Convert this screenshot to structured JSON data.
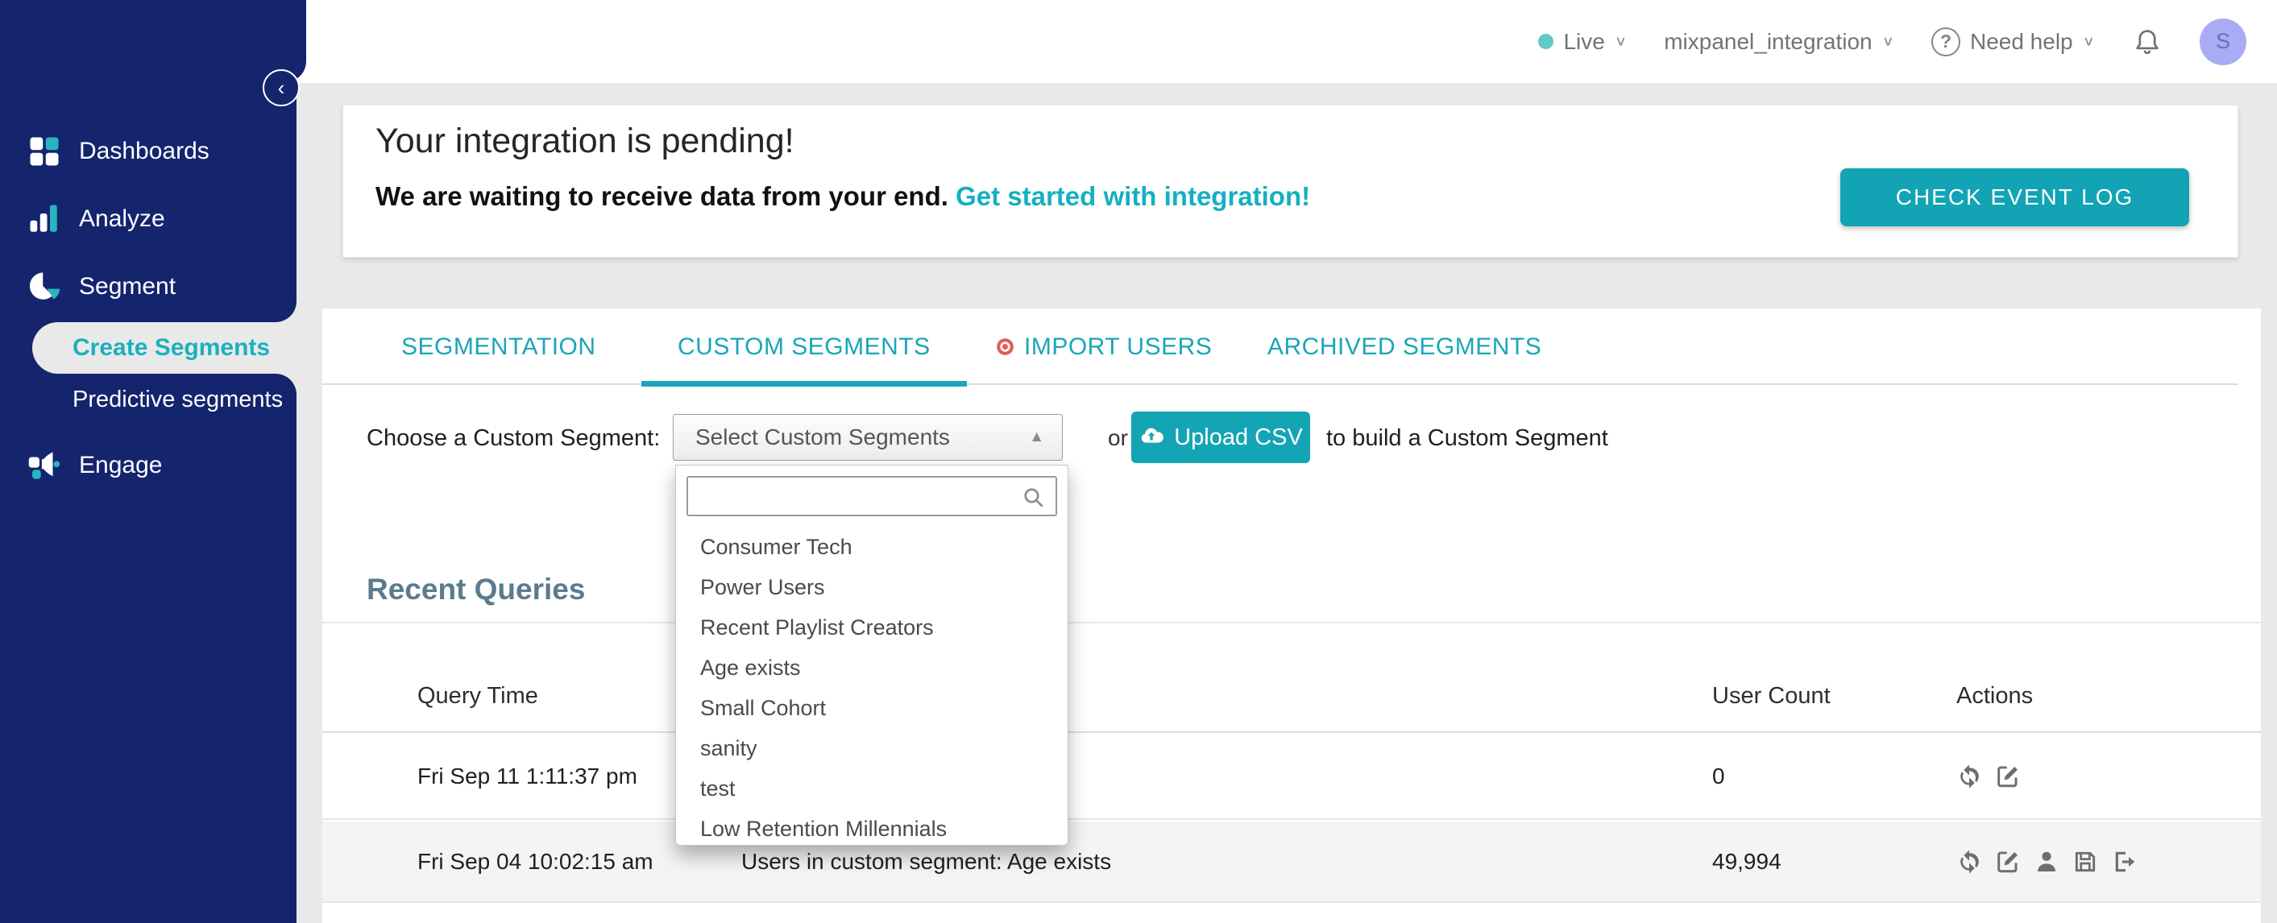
{
  "colors": {
    "navy": "#14256e",
    "accent_teal": "#14a5b5",
    "link_teal": "#14b0c0",
    "alert_red": "#e15b5b",
    "live_dot": "#62c9c3",
    "avatar_bg": "#a8acf4",
    "heading_slate": "#5b7b8e"
  },
  "sidebar": {
    "logo": "moengage",
    "items": [
      {
        "label": "Dashboards"
      },
      {
        "label": "Analyze"
      },
      {
        "label": "Segment"
      },
      {
        "label": "Create Segments",
        "active": true
      },
      {
        "label": "Predictive segments"
      },
      {
        "label": "Engage"
      }
    ]
  },
  "topbar": {
    "environment": "Live",
    "project": "mixpanel_integration",
    "help": "Need help",
    "avatar_initial": "S"
  },
  "banner": {
    "title": "Your integration is pending!",
    "message": "We are waiting to receive data from your end.",
    "link": "Get started with integration!",
    "button": "CHECK EVENT LOG"
  },
  "tabs": [
    {
      "label": "SEGMENTATION"
    },
    {
      "label": "CUSTOM SEGMENTS",
      "active": true
    },
    {
      "label": "IMPORT USERS",
      "badge": true
    },
    {
      "label": "ARCHIVED SEGMENTS"
    }
  ],
  "picker": {
    "label": "Choose a Custom Segment:",
    "selected": "Select Custom Segments",
    "or": "or",
    "upload_button": "Upload CSV",
    "suffix": "to build a Custom Segment",
    "search_value": "",
    "options": [
      "Consumer Tech",
      "Power Users",
      "Recent Playlist Creators",
      "Age exists",
      "Small Cohort",
      "sanity",
      "test",
      "Low Retention Millennials"
    ]
  },
  "recent_queries": {
    "title": "Recent Queries",
    "columns": {
      "time": "Query Time",
      "users": "User Count",
      "actions": "Actions"
    },
    "rows": [
      {
        "time": "Fri Sep 11 1:11:37 pm",
        "query": "",
        "user_count": "0"
      },
      {
        "time": "Fri Sep 04 10:02:15 am",
        "query": "Users in custom segment: Age exists",
        "user_count": "49,994"
      }
    ]
  }
}
